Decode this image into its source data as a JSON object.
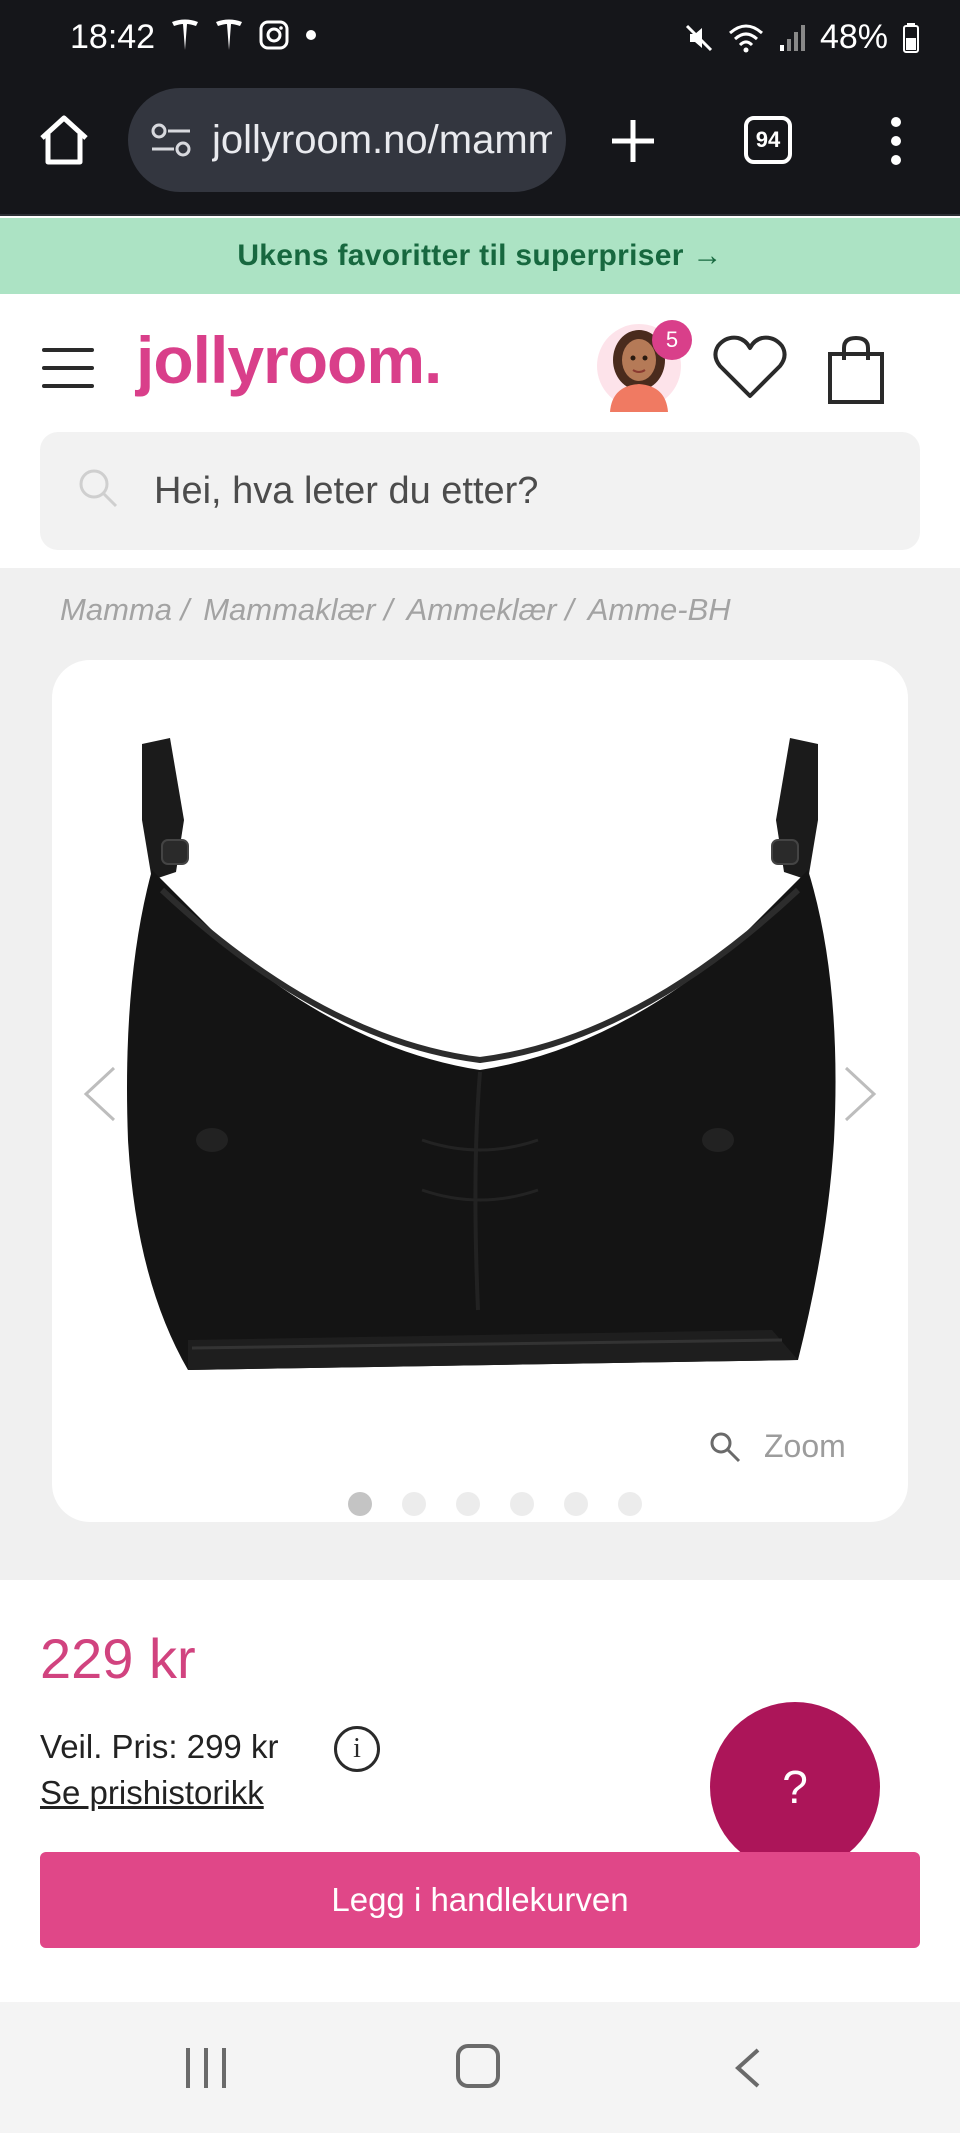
{
  "status_bar": {
    "time": "18:42",
    "battery": "48%"
  },
  "browser": {
    "url": "jollyroom.no/mamma",
    "tab_count": "94"
  },
  "promo": {
    "text": "Ukens favoritter til superpriser →"
  },
  "header": {
    "logo": "jollyroom.",
    "avatar_badge": "5",
    "search_placeholder": "Hei, hva leter du etter?"
  },
  "breadcrumb": [
    "Mamma /",
    "Mammaklær /",
    "Ammeklær /",
    "Amme-BH"
  ],
  "product": {
    "zoom_label": "Zoom",
    "image_count": 6,
    "active_image": 1
  },
  "pricing": {
    "price": "229 kr",
    "recommended_price": "Veil. Pris: 299 kr",
    "info_symbol": "i",
    "price_history_link": "Se prishistorikk",
    "add_to_cart": "Legg i handlekurven",
    "help_symbol": "?"
  },
  "colors": {
    "brand_pink": "#d93f8a",
    "cart_button": "#e04788",
    "help_button": "#ac1559",
    "promo_bg": "#ace3c4",
    "promo_text": "#17683f"
  }
}
